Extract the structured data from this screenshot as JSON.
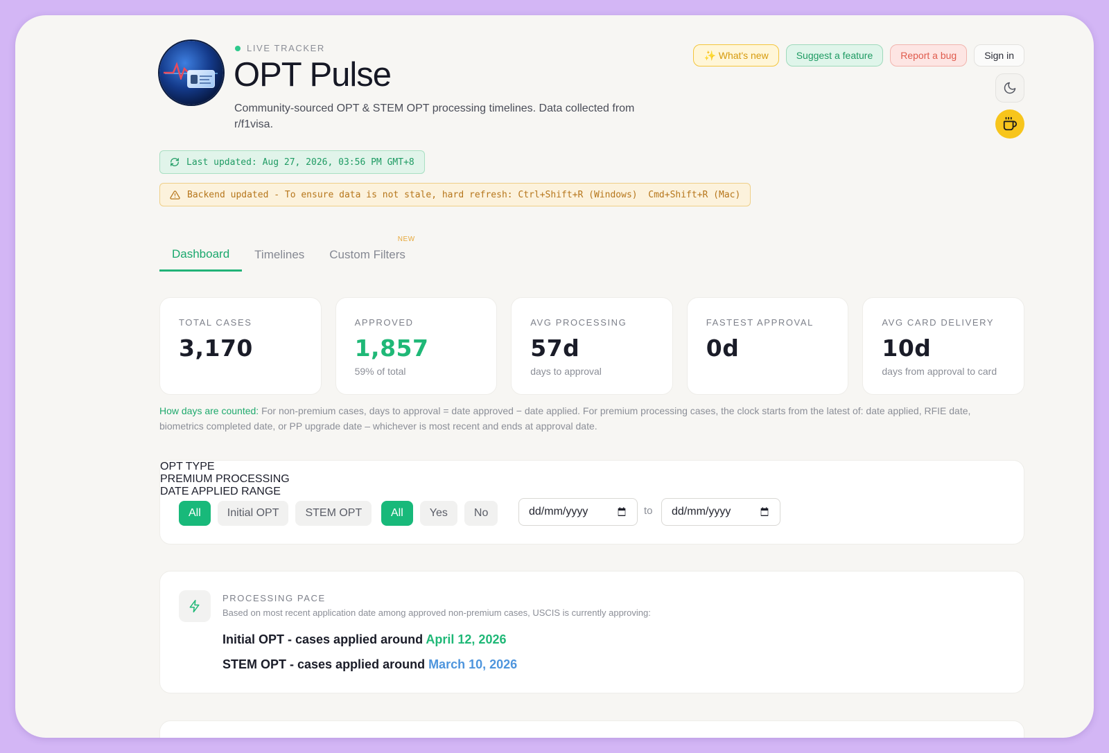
{
  "header": {
    "status": "LIVE TRACKER",
    "title": "OPT Pulse",
    "subtitle": "Community-sourced OPT & STEM OPT processing timelines. Data collected from r/f1visa."
  },
  "actions": {
    "whats_new": "✨ What's new",
    "suggest": "Suggest a feature",
    "report_bug": "Report a bug",
    "sign_in": "Sign in"
  },
  "banners": {
    "last_updated": "Last updated: Aug 27, 2026, 03:56 PM GMT+8",
    "warning": "Backend updated - To ensure data is not stale, hard refresh: Ctrl+Shift+R (Windows)  Cmd+Shift+R (Mac)"
  },
  "tabs": [
    {
      "label": "Dashboard",
      "active": true
    },
    {
      "label": "Timelines",
      "active": false
    },
    {
      "label": "Custom Filters",
      "badge": "NEW",
      "active": false
    }
  ],
  "stats": [
    {
      "label": "TOTAL CASES",
      "value": "3,170",
      "sub": ""
    },
    {
      "label": "APPROVED",
      "value": "1,857",
      "sub": "59% of total"
    },
    {
      "label": "AVG PROCESSING",
      "value": "57d",
      "sub": "days to approval"
    },
    {
      "label": "FASTEST APPROVAL",
      "value": "0d",
      "sub": ""
    },
    {
      "label": "AVG CARD DELIVERY",
      "value": "10d",
      "sub": "days from approval to card"
    }
  ],
  "note": {
    "lead": "How days are counted:",
    "text": " For non-premium cases, days to approval = date approved − date applied. For premium processing cases, the clock starts from the latest of: date applied, RFIE date, biometrics completed date, or PP upgrade date – whichever is most recent and ends at approval date."
  },
  "filters": {
    "opt_type": {
      "label": "OPT TYPE",
      "options": [
        "All",
        "Initial OPT",
        "STEM OPT"
      ],
      "selected": "All"
    },
    "premium": {
      "label": "PREMIUM PROCESSING",
      "options": [
        "All",
        "Yes",
        "No"
      ],
      "selected": "All"
    },
    "date_range": {
      "label": "DATE APPLIED RANGE",
      "from_placeholder": "dd/mm/yyyy",
      "to_placeholder": "dd/mm/yyyy",
      "separator": "to"
    }
  },
  "pace": {
    "label": "PROCESSING PACE",
    "description": "Based on most recent application date among approved non-premium cases, USCIS is currently approving:",
    "initial_prefix": "Initial OPT - cases applied around ",
    "initial_date": "April 12, 2026",
    "stem_prefix": "STEM OPT - cases applied around ",
    "stem_date": "March 10, 2026"
  },
  "colors": {
    "accent_green": "#1fb877",
    "accent_blue": "#4e95dd",
    "background": "#d3b6f5"
  }
}
